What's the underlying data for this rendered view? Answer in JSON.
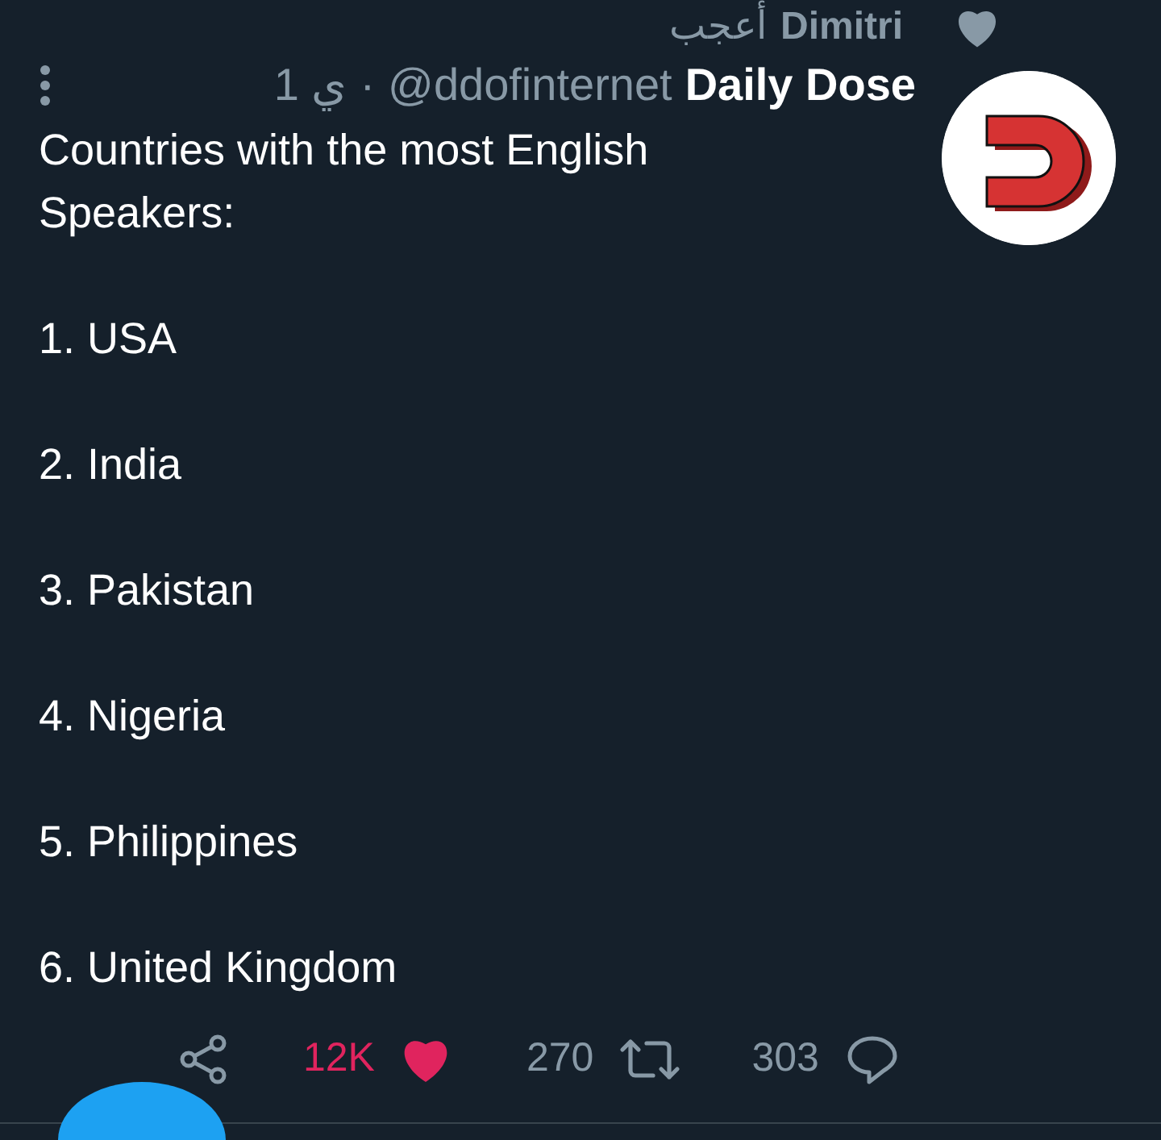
{
  "social_context": {
    "name": "Dimitri",
    "action": "أعجب"
  },
  "tweet": {
    "author": {
      "name": "Daily Dose",
      "handle": "@ddofinternet"
    },
    "separator": "·",
    "time": "1 ي",
    "text": "Countries with the most English Speakers:",
    "list": [
      "1. USA",
      "2. India",
      "3. Pakistan",
      "4. Nigeria",
      "5. Philippines",
      "6. United Kingdom"
    ],
    "actions": {
      "likes": {
        "count": "12K",
        "liked": true
      },
      "retweets": {
        "count": "270",
        "retweeted": false
      },
      "replies": {
        "count": "303"
      }
    }
  }
}
